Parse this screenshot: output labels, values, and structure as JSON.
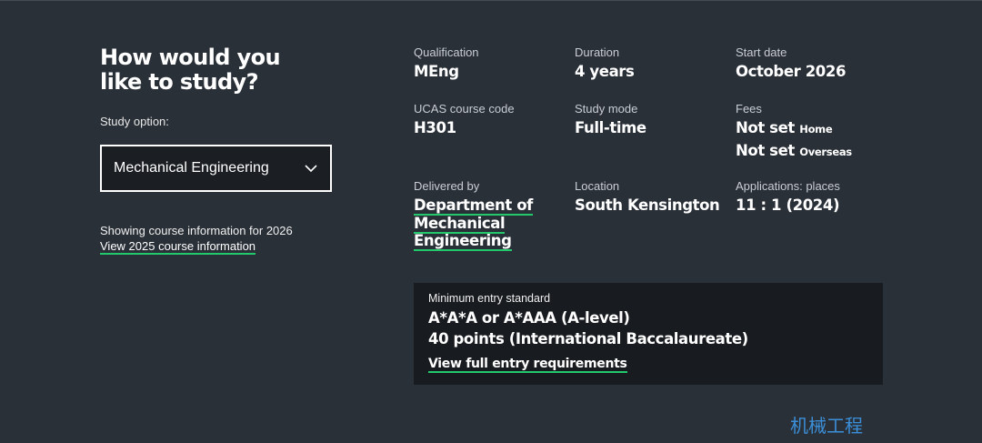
{
  "left": {
    "heading": "How would you like to study?",
    "study_option_label": "Study option:",
    "study_option_value": "Mechanical Engineering",
    "showing_text": "Showing course information for 2026",
    "view_other_link": "View 2025 course information"
  },
  "details": {
    "qualification": {
      "label": "Qualification",
      "value": "MEng"
    },
    "duration": {
      "label": "Duration",
      "value": "4 years"
    },
    "start_date": {
      "label": "Start date",
      "value": "October 2026"
    },
    "ucas": {
      "label": "UCAS course code",
      "value": "H301"
    },
    "study_mode": {
      "label": "Study mode",
      "value": "Full-time"
    },
    "fees": {
      "label": "Fees",
      "home_value": "Not set",
      "home_label": "Home",
      "overseas_value": "Not set",
      "overseas_label": "Overseas"
    },
    "delivered_by": {
      "label": "Delivered by",
      "line1": "Department of",
      "line2": "Mechanical",
      "line3": "Engineering"
    },
    "location": {
      "label": "Location",
      "value": "South Kensington"
    },
    "applications": {
      "label": "Applications: places",
      "value": "11 : 1 (2024)"
    }
  },
  "entry": {
    "label": "Minimum entry standard",
    "line1": "A*A*A or A*AAA (A-level)",
    "line2": "40 points (International Baccalaureate)",
    "link": "View full entry requirements"
  },
  "watermark": "机械工程",
  "colors": {
    "background": "#2a3038",
    "panel": "#181b1f",
    "accent_underline": "#22c86b",
    "watermark": "#3b8fd9"
  }
}
